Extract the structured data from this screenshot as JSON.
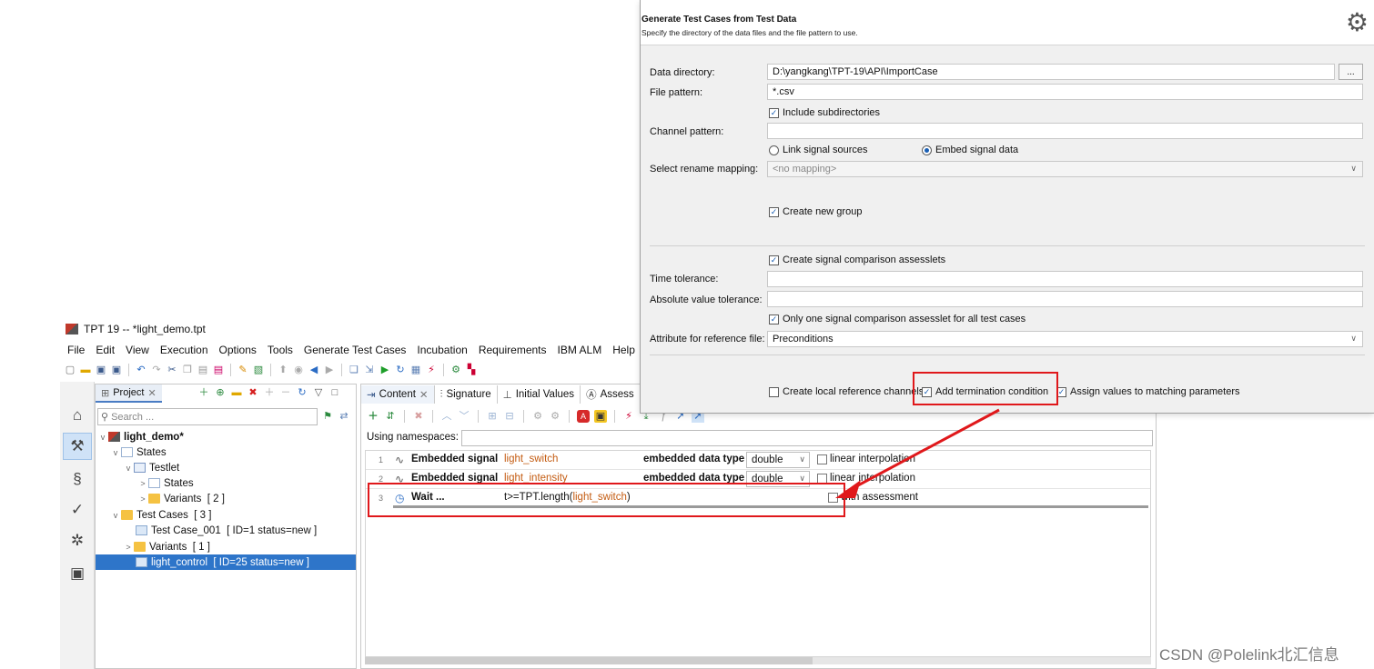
{
  "window": {
    "title": "TPT 19 -- *light_demo.tpt",
    "menu": [
      "File",
      "Edit",
      "View",
      "Execution",
      "Options",
      "Tools",
      "Generate Test Cases",
      "Incubation",
      "Requirements",
      "IBM ALM",
      "Help"
    ]
  },
  "project_panel": {
    "tab_label": "Project",
    "search_placeholder": "Search ...",
    "tree": [
      {
        "label": "light_demo*",
        "level": 0
      },
      {
        "label": "States",
        "level": 1
      },
      {
        "label": "Testlet",
        "level": 2
      },
      {
        "label": "States",
        "level": 3
      },
      {
        "label": "Variants",
        "suffix": "[ 2 ]",
        "level": 3
      },
      {
        "label": "Test Cases",
        "suffix": "[ 3 ]",
        "level": 1
      },
      {
        "label": "Test Case_001",
        "suffix": "[ ID=1 status=new ]",
        "level": 2
      },
      {
        "label": "Variants",
        "suffix": "[ 1 ]",
        "level": 2
      },
      {
        "label": "light_control",
        "suffix": "[ ID=25 status=new ]",
        "level": 2,
        "selected": true
      }
    ]
  },
  "content_panel": {
    "tabs": [
      "Content",
      "Signature",
      "Initial Values",
      "Assess"
    ],
    "namespaces_label": "Using namespaces:",
    "rows": [
      {
        "num": "1",
        "type": "Embedded signal",
        "name": "light_switch",
        "kw": "embedded data type",
        "dtype": "double",
        "check_label": "linear interpolation",
        "checked": false
      },
      {
        "num": "2",
        "type": "Embedded signal",
        "name": "light_intensity",
        "kw": "embedded data type",
        "dtype": "double",
        "check_label": "linear interpolation",
        "checked": false
      }
    ],
    "wait_row": {
      "num": "3",
      "type": "Wait ...",
      "condition_prefix": "t>=TPT.length(",
      "condition_arg": "light_switch",
      "condition_suffix": ")",
      "check_label": "with assessment",
      "checked": false
    }
  },
  "dialog": {
    "title": "Generate Test Cases from Test Data",
    "description": "Specify the directory of the data files and the file pattern to use.",
    "data_directory_label": "Data directory:",
    "data_directory_value": "D:\\yangkang\\TPT-19\\API\\ImportCase",
    "browse_label": "...",
    "file_pattern_label": "File pattern:",
    "file_pattern_value": "*.csv",
    "include_subdirs_label": "Include subdirectories",
    "channel_pattern_label": "Channel pattern:",
    "link_signal_label": "Link signal sources",
    "embed_signal_label": "Embed signal data",
    "rename_mapping_label": "Select rename mapping:",
    "rename_mapping_value": "<no mapping>",
    "create_group_label": "Create new group",
    "signal_comparison_label": "Create signal comparison assesslets",
    "time_tolerance_label": "Time tolerance:",
    "abs_tolerance_label": "Absolute value tolerance:",
    "only_one_label": "Only one signal comparison assesslet for all test cases",
    "reference_attr_label": "Attribute for reference file:",
    "reference_attr_value": "Preconditions",
    "local_channels_label": "Create local reference channels",
    "termination_label": "Add termination condition",
    "assign_values_label": "Assign values to matching parameters"
  },
  "watermark": "CSDN @Polelink北汇信息",
  "colors": {
    "highlight_red": "#e0181b",
    "selection_blue": "#2e75c9",
    "signal_name_orange": "#c45c12"
  }
}
